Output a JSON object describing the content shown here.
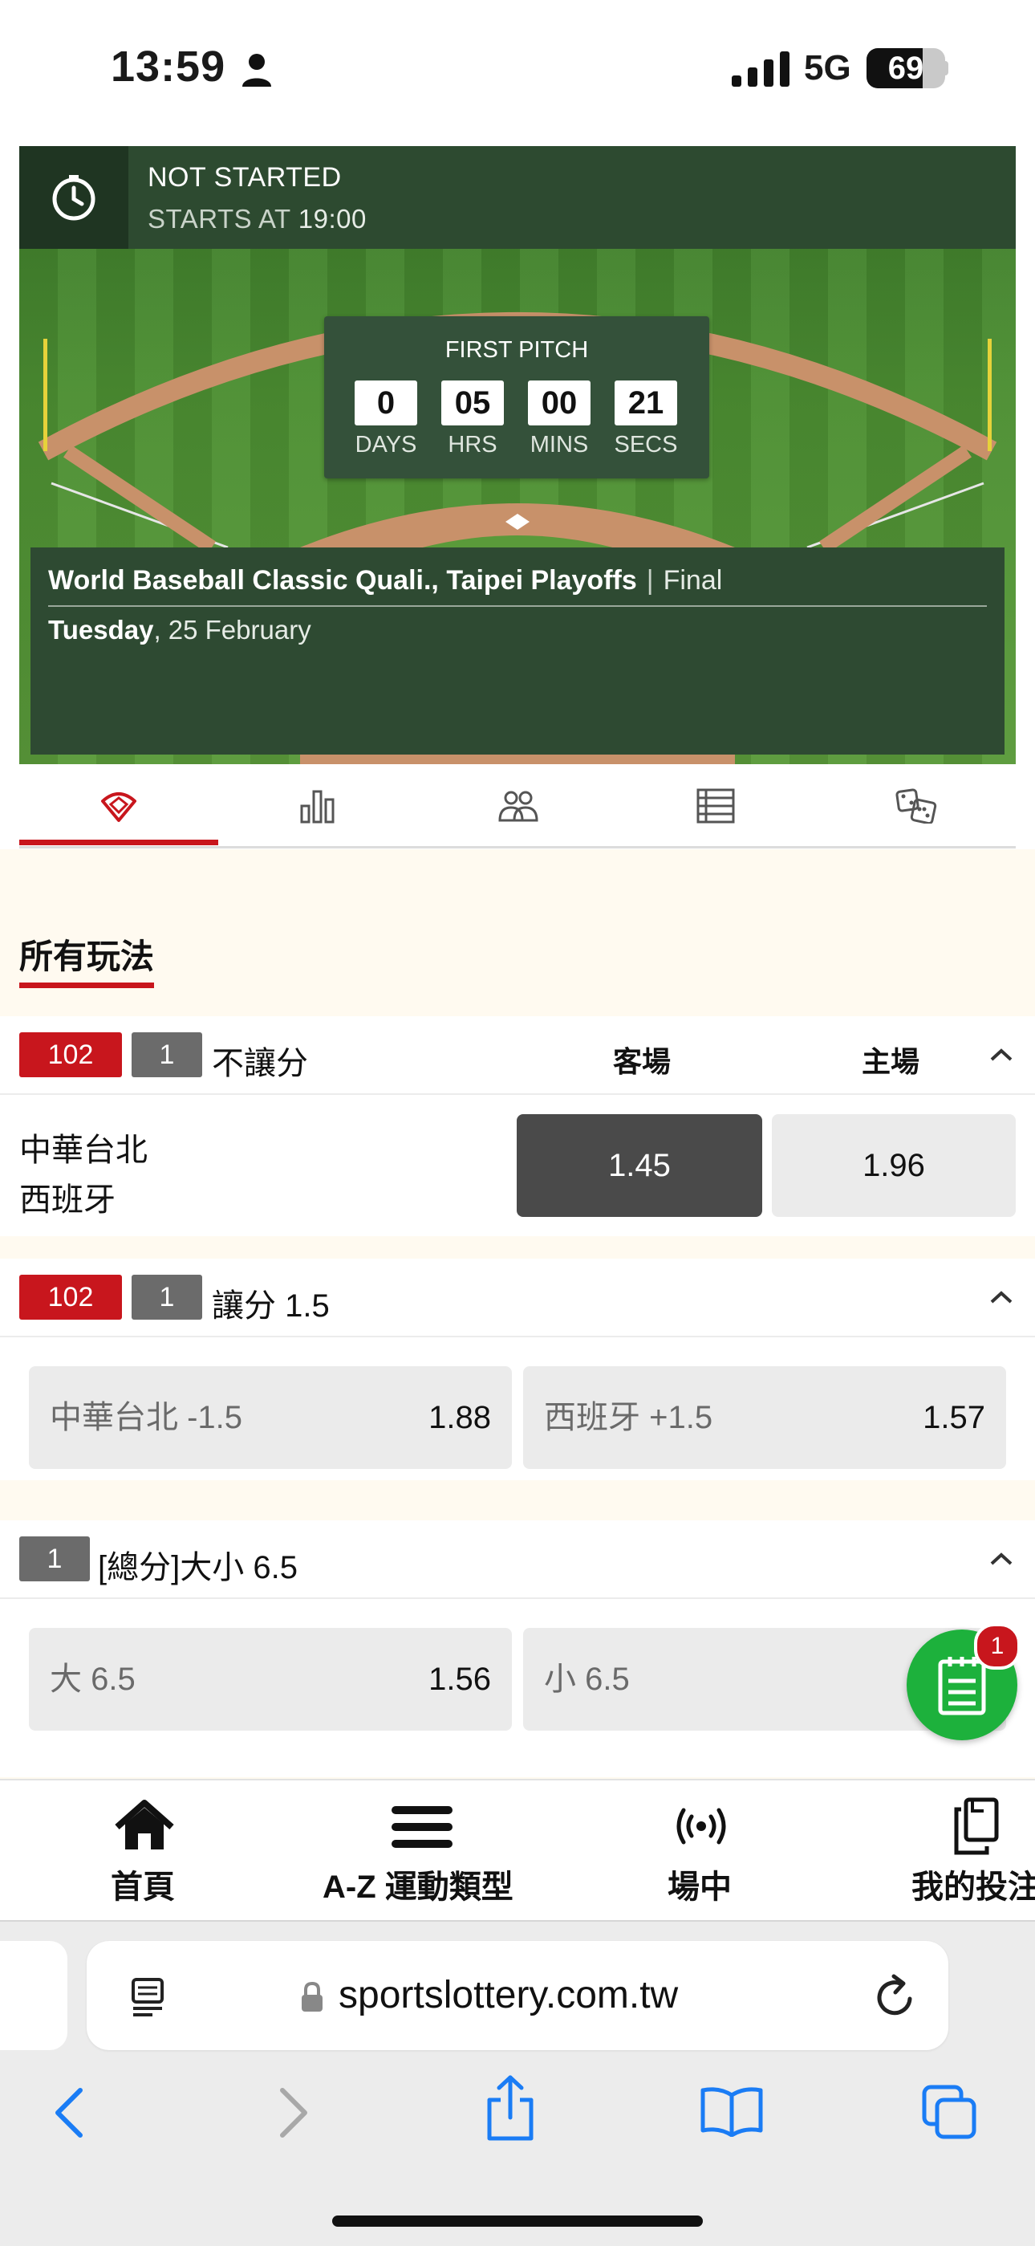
{
  "status_bar": {
    "time": "13:59",
    "network": "5G",
    "battery": "69"
  },
  "match": {
    "status": "NOT STARTED",
    "starts_at_label": "STARTS AT",
    "starts_at_time": "19:00",
    "countdown": {
      "title": "FIRST PITCH",
      "days": "0",
      "hours": "05",
      "mins": "00",
      "secs": "21",
      "days_label": "DAYS",
      "hours_label": "HRS",
      "mins_label": "MINS",
      "secs_label": "SECS"
    },
    "competition": "World Baseball Classic Quali., Taipei Playoffs",
    "separator": "|",
    "stage": "Final",
    "weekday": "Tuesday",
    "date": ", 25 February"
  },
  "tabs": [
    {
      "icon": "baseball-field-icon",
      "active": true
    },
    {
      "icon": "bar-chart-icon",
      "active": false
    },
    {
      "icon": "team-lineup-icon",
      "active": false
    },
    {
      "icon": "list-icon",
      "active": false
    },
    {
      "icon": "dice-icon",
      "active": false
    }
  ],
  "markets_title": "所有玩法",
  "markets": {
    "moneyline": {
      "game_no": "102",
      "period": "1",
      "name": "不讓分",
      "away_label": "客場",
      "home_label": "主場",
      "team_away": "中華台北",
      "team_home": "西班牙",
      "away_odds": "1.45",
      "home_odds": "1.96"
    },
    "handicap": {
      "game_no": "102",
      "period": "1",
      "name": "讓分 1.5",
      "option_a_label": "中華台北 -1.5",
      "option_a_odds": "1.88",
      "option_b_label": "西班牙 +1.5",
      "option_b_odds": "1.57"
    },
    "total": {
      "period": "1",
      "name": "[總分]大小 6.5",
      "over_label": "大 6.5",
      "over_odds": "1.56",
      "under_label": "小 6.5"
    }
  },
  "bet_slip": {
    "count": "1"
  },
  "bottom_nav": [
    {
      "label": "首頁",
      "icon": "home-icon"
    },
    {
      "label": "A-Z 運動類型",
      "icon": "menu-icon"
    },
    {
      "label": "場中",
      "icon": "live-broadcast-icon"
    },
    {
      "label": "我的投注",
      "icon": "my-bets-icon"
    }
  ],
  "browser": {
    "url": "sportslottery.com.tw"
  },
  "colors": {
    "accent_red": "#c8161d",
    "field_green": "#4c8f32",
    "panel_green": "#2e4a32",
    "fab_green": "#1db13c",
    "ios_blue": "#1a7cf5"
  }
}
